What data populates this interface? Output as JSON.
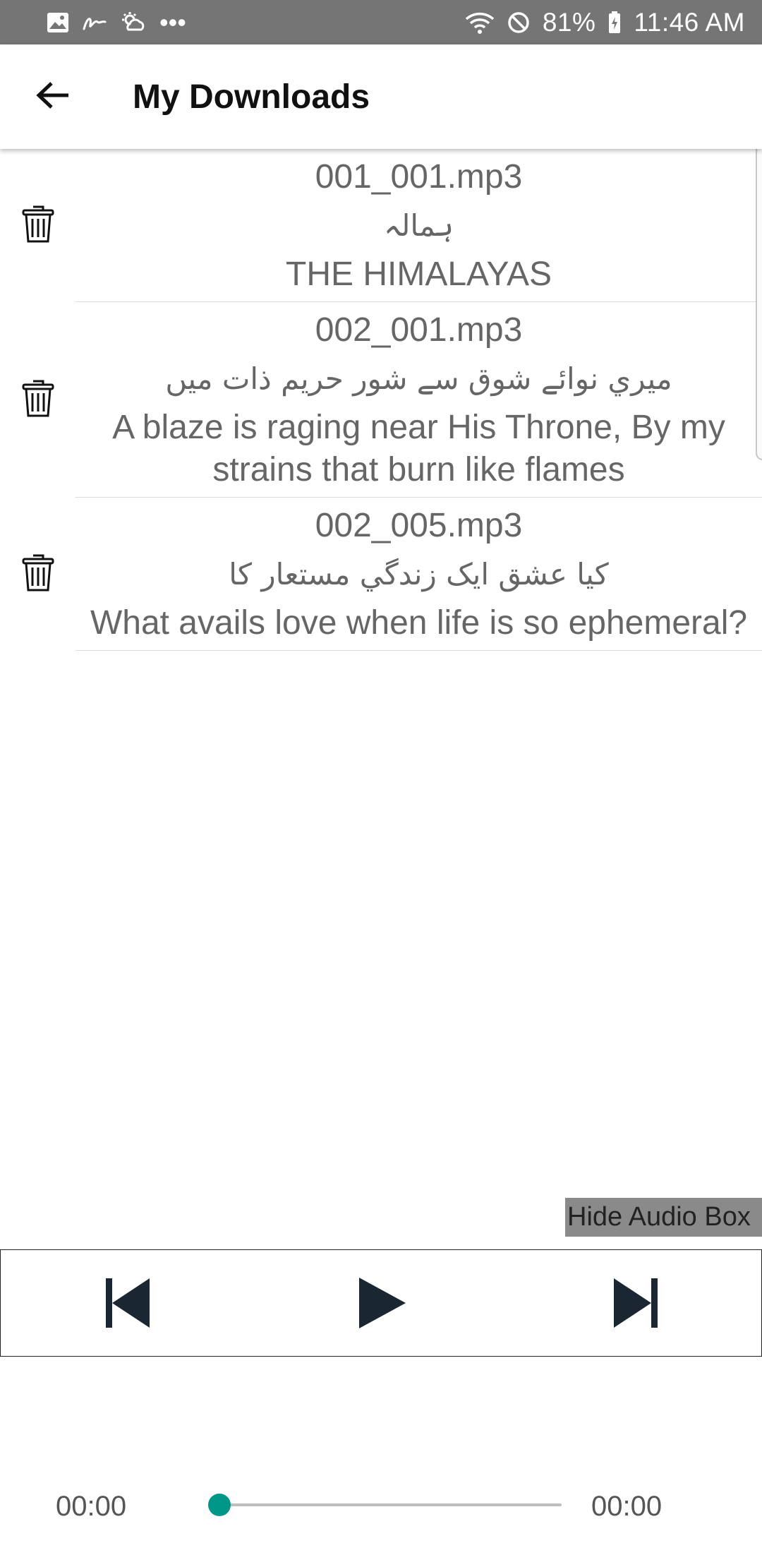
{
  "status_bar": {
    "battery": "81%",
    "time": "11:46 AM",
    "dots": "•••"
  },
  "header": {
    "title": "My Downloads"
  },
  "downloads": [
    {
      "file": "001_001.mp3",
      "urdu": "ہمالہ",
      "english": "THE HIMALAYAS"
    },
    {
      "file": "002_001.mp3",
      "urdu": "ميري نوائے شوق سے شور حریم ذات میں",
      "english": "A blaze is raging near His Throne, By my strains that burn like flames"
    },
    {
      "file": "002_005.mp3",
      "urdu": "کیا عشق ایک زندگي مستعار کا",
      "english": "What avails love when life is so ephemeral?"
    }
  ],
  "audio": {
    "hide_label": "Hide Audio Box",
    "current_time": "00:00",
    "total_time": "00:00",
    "progress": 0
  },
  "colors": {
    "status_bar": "#757575",
    "accent": "#009688",
    "control_icon": "#1a2733",
    "text_secondary": "#666666"
  }
}
